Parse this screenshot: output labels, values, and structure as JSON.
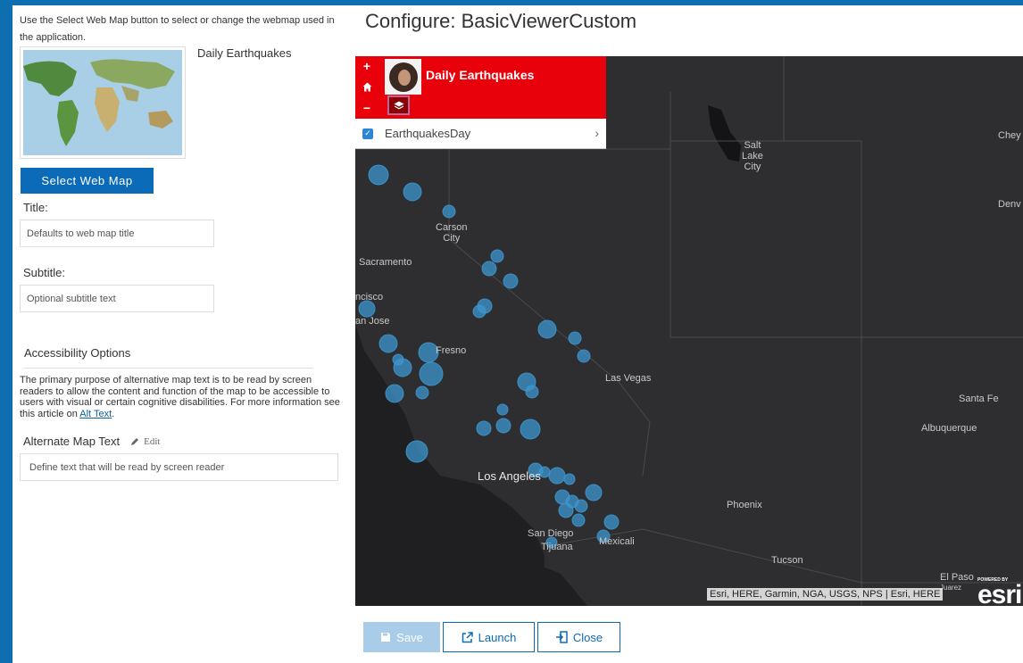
{
  "left_panel": {
    "intro_text": "Use the Select Web Map button to select or change the webmap used in the application.",
    "webmap_name": "Daily Earthquakes",
    "select_button_label": "Select Web Map",
    "title_label": "Title:",
    "title_placeholder": "Defaults to web map title",
    "subtitle_label": "Subtitle:",
    "subtitle_placeholder": "Optional subtitle text",
    "accessibility_title": "Accessibility Options",
    "accessibility_text": "The primary purpose of alternative map text is to be read by screen readers to allow the content and function of the map to be accessible to users with visual or certain cognitive disabilities. For more information see this article on",
    "alt_text_link": "Alt Text",
    "alt_text_link_suffix": ".",
    "alt_map_text_label": "Alternate Map Text",
    "edit_label": "Edit",
    "alt_map_placeholder": "Define text that will be read by screen reader"
  },
  "header": {
    "title": "Configure: BasicViewerCustom"
  },
  "map": {
    "panel_title": "Daily Earthquakes",
    "zoom_in": "+",
    "home_icon": "home-icon",
    "zoom_out": "−",
    "layer_name": "EarthquakesDay",
    "attribution": "Esri, HERE, Garmin, NGA, USGS, NPS | Esri, HERE",
    "powered_by": "POWERED BY",
    "logo_text": "esri",
    "cities": {
      "chey": "Chey",
      "salt_lake": "Salt\nLake\nCity",
      "denv": "Denv",
      "carson": "Carson\nCity",
      "sacramento": "Sacramento",
      "francisco": "ncisco",
      "san_jose": "an Jose",
      "fresno": "Fresno",
      "las_vegas": "Las Vegas",
      "santa_fe": "Santa Fe",
      "albuquerque": "Albuquerque",
      "los_angeles": "Los Angeles",
      "phoenix": "Phoenix",
      "san_diego": "San Diego",
      "tijuana": "Tijuana",
      "mexicali": "Mexicali",
      "tucson": "Tucson",
      "el_paso": "El Paso",
      "juarez": "Juarez"
    },
    "colors": {
      "panel": "#e8000b",
      "quake": "#3d95cf",
      "land": "#2e2e30"
    }
  },
  "footer": {
    "save_label": "Save",
    "launch_label": "Launch",
    "close_label": "Close"
  }
}
